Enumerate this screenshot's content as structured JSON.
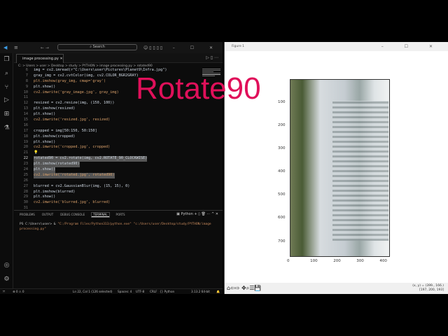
{
  "vscode": {
    "search": "Search",
    "tab": "image processing.py",
    "breadcrumb": "C: > Users > user > Desktop > study > PYTHON > image processing.py > rotated90",
    "code": [
      {
        "n": "6",
        "t": "img = cv2.imread(r\"C:\\Users\\user\\Pictures\\Planet9\\Infra.jpg\")"
      },
      {
        "n": "7",
        "t": "gray_img = cv2.cvtColor(img, cv2.COLOR_BGR2GRAY)"
      },
      {
        "n": "8",
        "t": "plt.imshow(gray_img, cmap='gray')"
      },
      {
        "n": "9",
        "t": "plt.show()"
      },
      {
        "n": "10",
        "t": "cv2.imwrite('gray_image.jpg', gray_img)"
      },
      {
        "n": "11",
        "t": ""
      },
      {
        "n": "12",
        "t": "resized = cv2.resize(img, (150, 100))"
      },
      {
        "n": "13",
        "t": "plt.imshow(resized)"
      },
      {
        "n": "14",
        "t": "plt.show()"
      },
      {
        "n": "15",
        "t": "cv2.imwrite('resized.jpg', resized)"
      },
      {
        "n": "16",
        "t": ""
      },
      {
        "n": "17",
        "t": "cropped = img[50:150, 50:150]"
      },
      {
        "n": "18",
        "t": "plt.imshow(cropped)"
      },
      {
        "n": "19",
        "t": "plt.show()"
      },
      {
        "n": "20",
        "t": "cv2.imwrite('cropped.jpg', cropped)"
      },
      {
        "n": "21",
        "t": "💡"
      },
      {
        "n": "22",
        "t": "rotated90 = cv2.rotate(img, cv2.ROTATE_90_CLOCKWISE)"
      },
      {
        "n": "23",
        "t": "plt.imshow(rotated90)"
      },
      {
        "n": "24",
        "t": "plt.show()"
      },
      {
        "n": "25",
        "t": "cv2.imwrite('rotated.jpg', rotated90)"
      },
      {
        "n": "26",
        "t": ""
      },
      {
        "n": "27",
        "t": "blurred = cv2.GaussianBlur(img, (15, 15), 0)"
      },
      {
        "n": "28",
        "t": "plt.imshow(blurred)"
      },
      {
        "n": "29",
        "t": "plt.show()"
      },
      {
        "n": "30",
        "t": "cv2.imwrite('blurred.jpg', blurred)"
      },
      {
        "n": "31",
        "t": ""
      }
    ],
    "panel_tabs": [
      "PROBLEMS",
      "OUTPUT",
      "DEBUG CONSOLE",
      "TERMINAL",
      "PORTS"
    ],
    "terminal_profile": "Python",
    "terminal_prompt": "PS C:\\Users\\user> & ",
    "terminal_cmd": "\"C:/Program Files/Python313/python.exe\" \"c:/Users/user/Desktop/study/PYTHON/image processing.py\"",
    "status": {
      "problems": "⊗ 0 ⚠ 0",
      "position": "Ln 22, Col 1 (126 selected)",
      "spaces": "Spaces: 4",
      "encoding": "UTF-8",
      "eol": "CRLF",
      "language": "{} Python",
      "interpreter": "3.13.2 64-bit"
    }
  },
  "overlay_text": "Rotate90",
  "figure": {
    "title": "Figure 1",
    "yticks": [
      "100",
      "200",
      "300",
      "400",
      "500",
      "600",
      "700"
    ],
    "xticks": [
      "0",
      "100",
      "200",
      "300",
      "400"
    ],
    "coords": "(x, y) = (399., 166.)",
    "pixel": "[197, 200, 193]"
  }
}
